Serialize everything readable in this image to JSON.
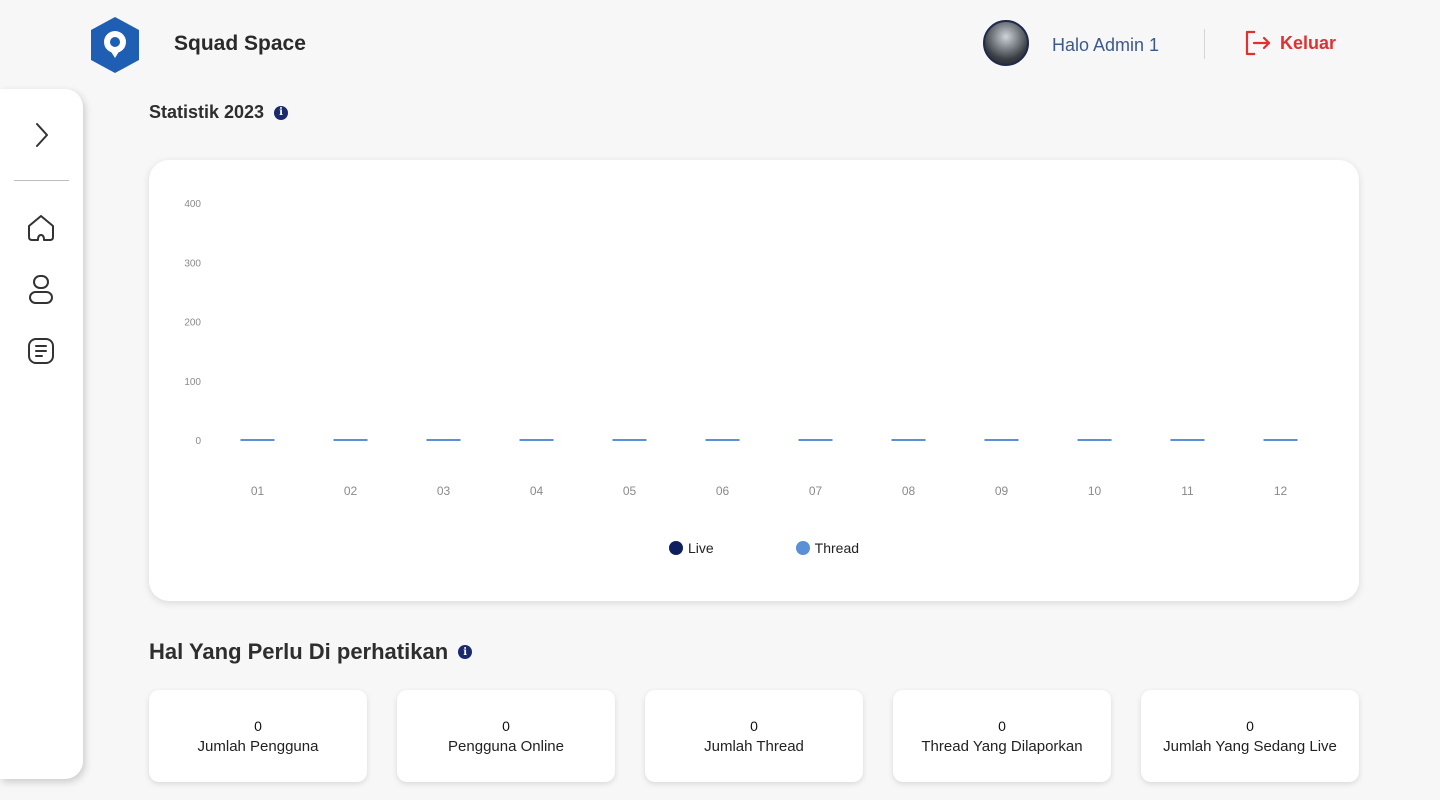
{
  "header": {
    "brand": "Squad Space",
    "greeting": "Halo Admin 1",
    "logout_label": "Keluar"
  },
  "sidebar": {
    "items": [
      {
        "icon": "chevron-right-icon"
      },
      {
        "icon": "home-icon"
      },
      {
        "icon": "user-icon"
      },
      {
        "icon": "document-icon"
      }
    ]
  },
  "statistics": {
    "title": "Statistik 2023"
  },
  "attention": {
    "title": "Hal Yang Perlu Di perhatikan"
  },
  "stats": [
    {
      "value": "0",
      "label": "Jumlah Pengguna"
    },
    {
      "value": "0",
      "label": "Pengguna Online"
    },
    {
      "value": "0",
      "label": "Jumlah Thread"
    },
    {
      "value": "0",
      "label": "Thread Yang Dilaporkan"
    },
    {
      "value": "0",
      "label": "Jumlah Yang Sedang Live"
    }
  ],
  "colors": {
    "brand_blue": "#1e5fb4",
    "live": "#0d1f5c",
    "thread": "#5b8fd6",
    "logout": "#e03030"
  },
  "chart_data": {
    "type": "bar",
    "categories": [
      "01",
      "02",
      "03",
      "04",
      "05",
      "06",
      "07",
      "08",
      "09",
      "10",
      "11",
      "12"
    ],
    "series": [
      {
        "name": "Live",
        "values": [
          0,
          0,
          0,
          0,
          0,
          0,
          0,
          0,
          0,
          0,
          0,
          0
        ]
      },
      {
        "name": "Thread",
        "values": [
          0,
          0,
          0,
          0,
          0,
          0,
          0,
          0,
          0,
          0,
          0,
          0
        ]
      }
    ],
    "ylim": [
      0,
      400
    ],
    "yticks": [
      0,
      100,
      200,
      300,
      400
    ],
    "grid": false,
    "legend": "bottom-center"
  }
}
